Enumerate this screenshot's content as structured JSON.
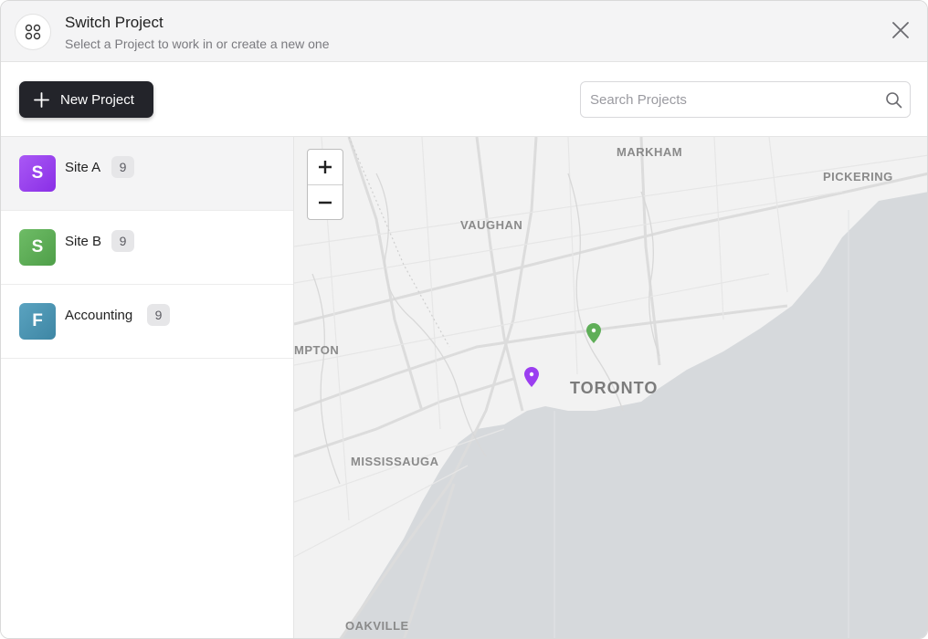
{
  "header": {
    "title": "Switch Project",
    "subtitle": "Select a Project to work in or create a new one"
  },
  "toolbar": {
    "new_project_label": "New Project",
    "search_placeholder": "Search Projects",
    "search_value": ""
  },
  "projects": [
    {
      "initial": "S",
      "name": "Site A",
      "count": "9",
      "color": "#9b3ef0",
      "active": true
    },
    {
      "initial": "S",
      "name": "Site B",
      "count": "9",
      "color": "#5fae58",
      "active": false
    },
    {
      "initial": "F",
      "name": "Accounting",
      "count": "9",
      "color": "#4a92b0",
      "active": false
    }
  ],
  "map": {
    "zoom_in": "+",
    "zoom_out": "−",
    "labels": {
      "markham": "MARKHAM",
      "pickering": "PICKERING",
      "vaughan": "VAUGHAN",
      "brampton": "MPTON",
      "toronto": "TORONTO",
      "mississauga": "MISSISSAUGA",
      "oakville": "OAKVILLE"
    },
    "colors": {
      "land": "#f2f2f2",
      "water": "#d6d9dc",
      "pin_site_a": "#9b3ef0",
      "pin_site_b": "#5fae58"
    }
  },
  "icons": {
    "header": "apps-grid-icon",
    "close": "close-icon",
    "new": "plus-icon",
    "search": "search-icon"
  }
}
